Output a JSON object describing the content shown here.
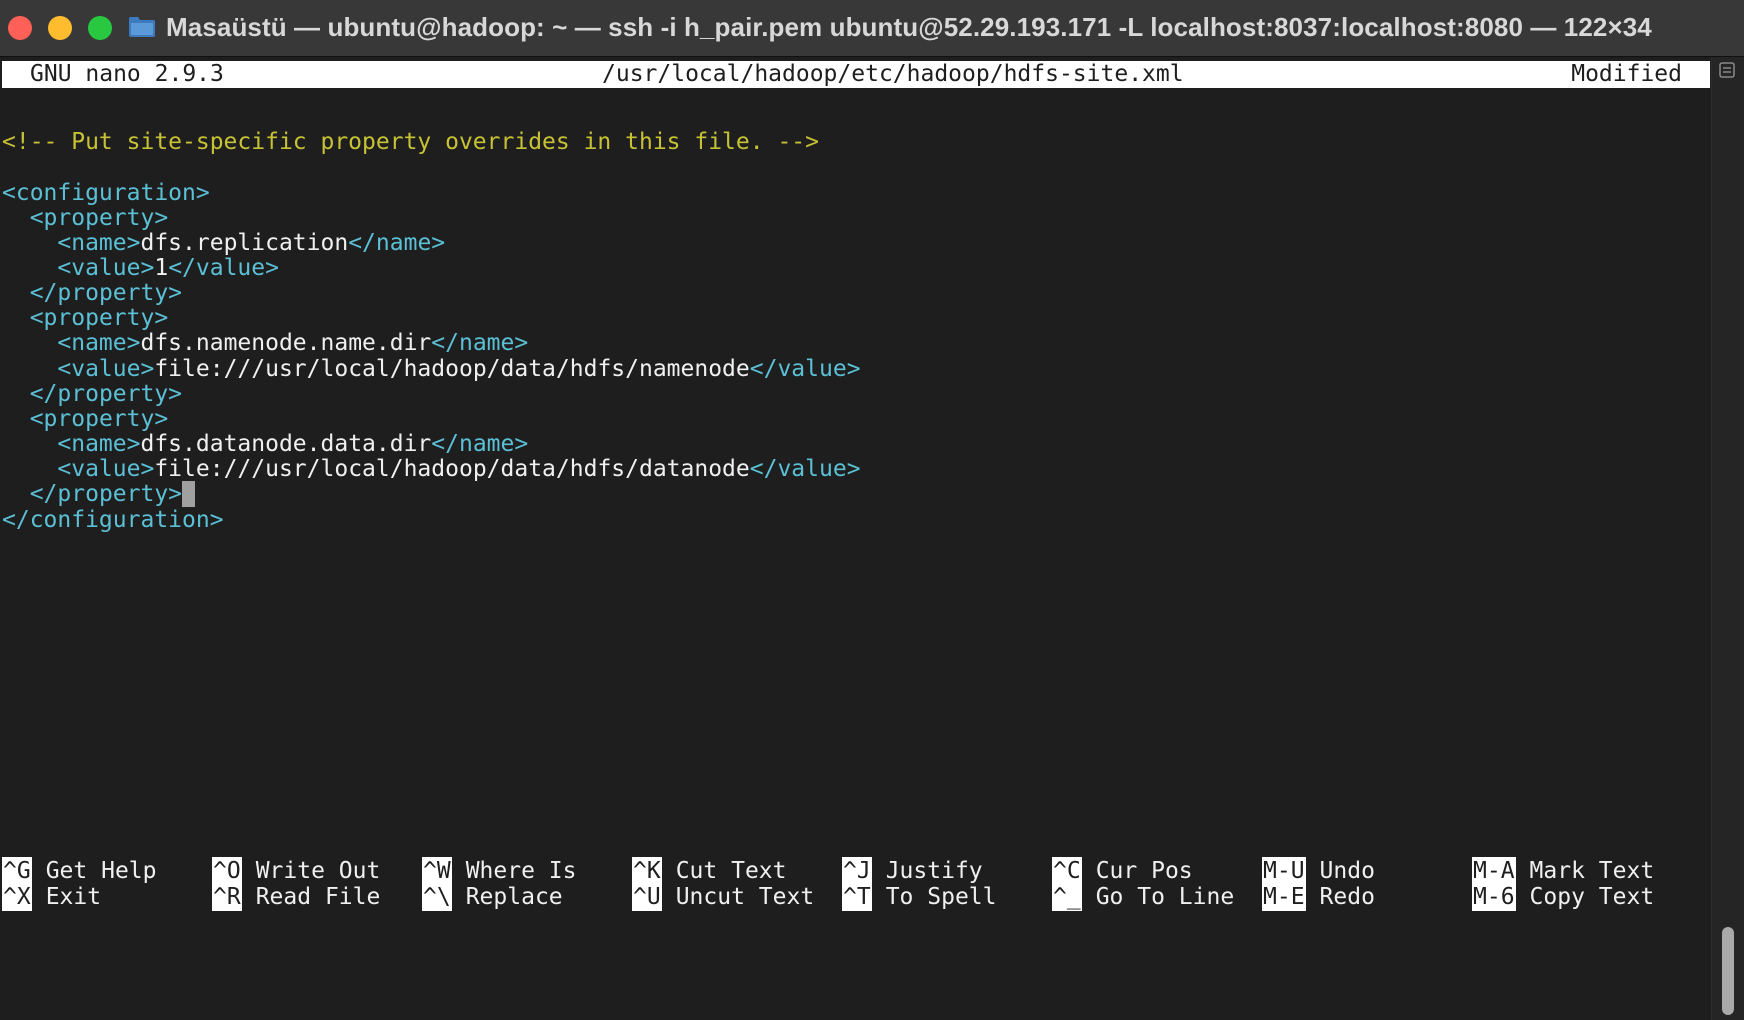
{
  "window": {
    "title": "Masaüstü — ubuntu@hadoop: ~ — ssh -i h_pair.pem ubuntu@52.29.193.171 -L localhost:8037:localhost:8080 — 122×34"
  },
  "nano": {
    "version": "GNU nano 2.9.3",
    "file_path": "/usr/local/hadoop/etc/hadoop/hdfs-site.xml",
    "status": "Modified"
  },
  "editor": {
    "comment": "<!-- Put site-specific property overrides in this file. -->",
    "config_open": "<configuration>",
    "config_close": "</configuration>",
    "property_open": "<property>",
    "property_close": "</property>",
    "name_open": "<name>",
    "name_close": "</name>",
    "value_open": "<value>",
    "value_close": "</value>",
    "properties": [
      {
        "name": "dfs.replication",
        "value": "1"
      },
      {
        "name": "dfs.namenode.name.dir",
        "value": "file:///usr/local/hadoop/data/hdfs/namenode"
      },
      {
        "name": "dfs.datanode.data.dir",
        "value": "file:///usr/local/hadoop/data/hdfs/datanode"
      }
    ]
  },
  "shortcuts": [
    {
      "key": "^G",
      "label": "Get Help"
    },
    {
      "key": "^O",
      "label": "Write Out"
    },
    {
      "key": "^W",
      "label": "Where Is"
    },
    {
      "key": "^K",
      "label": "Cut Text"
    },
    {
      "key": "^J",
      "label": "Justify"
    },
    {
      "key": "^C",
      "label": "Cur Pos"
    },
    {
      "key": "M-U",
      "label": "Undo"
    },
    {
      "key": "M-A",
      "label": "Mark Text"
    },
    {
      "key": "^X",
      "label": "Exit"
    },
    {
      "key": "^R",
      "label": "Read File"
    },
    {
      "key": "^\\",
      "label": "Replace"
    },
    {
      "key": "^U",
      "label": "Uncut Text"
    },
    {
      "key": "^T",
      "label": "To Spell"
    },
    {
      "key": "^_",
      "label": "Go To Line"
    },
    {
      "key": "M-E",
      "label": "Redo"
    },
    {
      "key": "M-6",
      "label": "Copy Text"
    }
  ],
  "colors": {
    "background": "#1e1e1e",
    "comment": "#c7c234",
    "tag": "#5bc0d6",
    "text": "#f0f0f0",
    "titlebar": "#383838"
  }
}
